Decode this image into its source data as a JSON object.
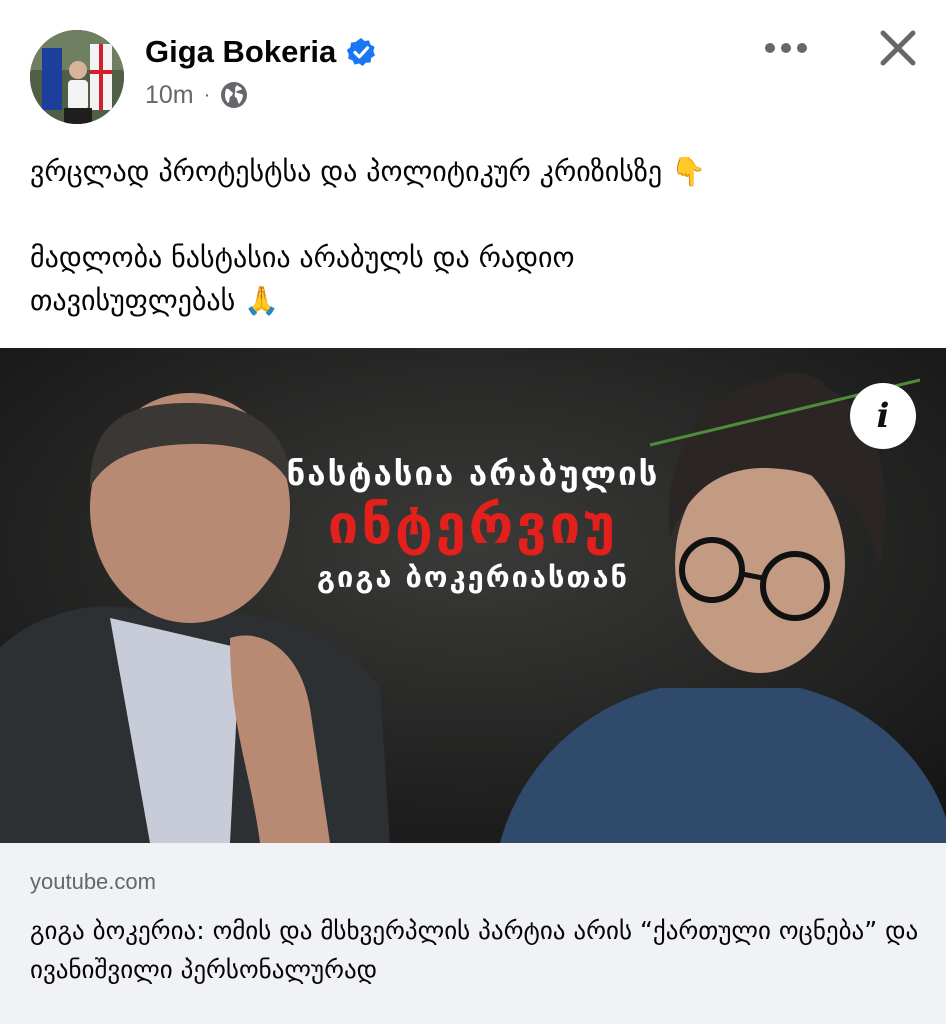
{
  "post": {
    "author": "Giga Bokeria",
    "time": "10m",
    "separator": "·",
    "text_line_1": "ვრცლად პროტესტსა და პოლიტიკურ კრიზისზე 👇",
    "text_line_2": "მადლობა ნასტასია არაბულს და რადიო\nთავისუფლებას 🙏"
  },
  "media": {
    "overlay_line_1": "ნასტასია არაბულის",
    "overlay_line_2": "ინტერვიუ",
    "overlay_line_3": "გიგა ბოკერიასთან",
    "info_label": "i"
  },
  "link": {
    "domain": "youtube.com",
    "title": "გიგა ბოკერია: ომის და მსხვერპლის პარტია არის “ქართული ოცნება” და ივანიშვილი პერსონალურად"
  },
  "icons": {
    "verified": "verified-badge-icon",
    "audience": "globe-icon",
    "more": "more-options-icon",
    "close": "close-icon",
    "info": "info-icon"
  },
  "colors": {
    "verified": "#1877f2",
    "secondary_text": "#65676b",
    "overlay_accent": "#e3201b",
    "card_bg": "#f0f2f5"
  }
}
